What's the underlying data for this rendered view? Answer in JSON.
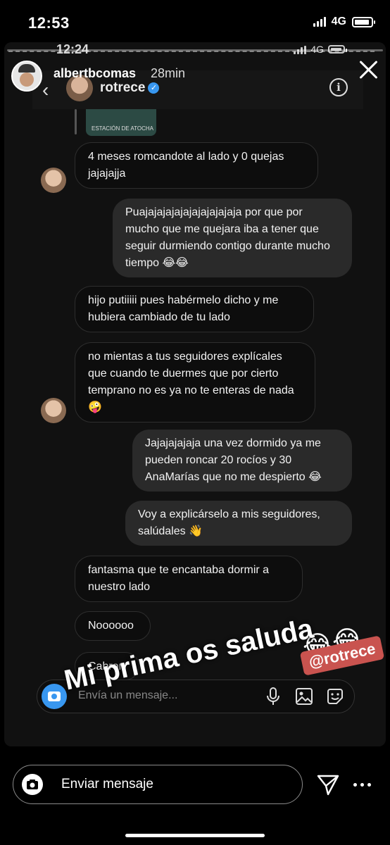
{
  "status_bar": {
    "time": "12:53",
    "network": "4G"
  },
  "inner_status_bar": {
    "time": "12:24",
    "network": "4G"
  },
  "story": {
    "username": "albertbcomas",
    "time_ago": "28min",
    "overlay_text": "Mi prima os saluda",
    "emoji_stickers": [
      "😂",
      "😂"
    ],
    "mention_sticker": "@rotrece"
  },
  "inner_chat": {
    "contact_name": "rotrece",
    "shared_label": "ESTACIÓN DE ATOCHA",
    "messages": [
      {
        "dir": "in",
        "text": "4 meses romcandote al lado y 0 quejas jajajajja"
      },
      {
        "dir": "out",
        "text": "Puajajajajajajajajajajaja por que por mucho que me quejara iba a tener que seguir durmiendo contigo durante mucho tiempo 😂😂"
      },
      {
        "dir": "in",
        "text": "hijo putiiiii pues habérmelo dicho y me hubiera cambiado de tu lado"
      },
      {
        "dir": "in",
        "text": "no mientas a tus seguidores explícales que cuando te duermes que por cierto temprano no es ya no te enteras de nada 🤪"
      },
      {
        "dir": "out",
        "text": "Jajajajajaja una vez dormido ya me pueden roncar 20 rocíos y 30 AnaMarías que no me despierto 😂"
      },
      {
        "dir": "out",
        "text": "Voy a explicárselo a mis seguidores, salúdales 👋"
      },
      {
        "dir": "in",
        "text": "fantasma que te encantaba dormir a nuestro lado"
      },
      {
        "dir": "in",
        "text": "Noooooo"
      },
      {
        "dir": "in",
        "text": "Cabron"
      }
    ],
    "composer_placeholder": "Envía un mensaje..."
  },
  "reply_bar": {
    "placeholder": "Enviar mensaje"
  }
}
